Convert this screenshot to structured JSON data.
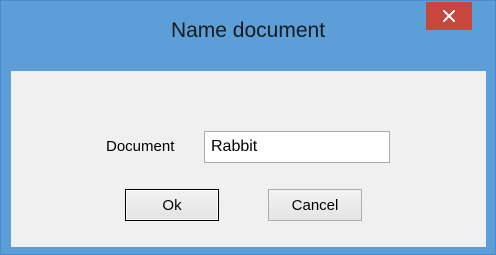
{
  "window": {
    "title": "Name document",
    "close_icon": "close-icon",
    "colors": {
      "frame": "#5c9ed8",
      "close_button": "#c7463e",
      "client": "#f0f0f0"
    }
  },
  "form": {
    "document_label": "Document",
    "document_value": "Rabbit"
  },
  "buttons": {
    "ok_label": "Ok",
    "cancel_label": "Cancel"
  }
}
